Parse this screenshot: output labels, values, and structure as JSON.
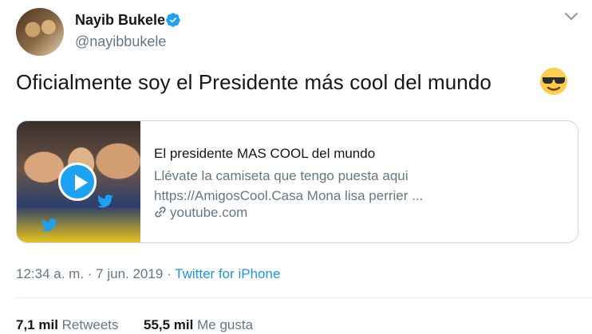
{
  "author": {
    "name": "Nayib Bukele",
    "handle": "@nayibbukele",
    "verified_color": "#1da1f2"
  },
  "tweet": {
    "text": "Oficialmente soy el Presidente más cool del mundo",
    "emoji": "smiling-face-with-sunglasses"
  },
  "card": {
    "title": "El presidente MAS COOL del mundo",
    "description_line1": "Llévate la camiseta que tengo puesta aqui",
    "description_line2": "https://AmigosCool.Casa Mona lisa perrier ...",
    "domain": "youtube.com"
  },
  "meta": {
    "timestamp": "12:34 a. m. · 7 jun. 2019",
    "separator": "·",
    "source": "Twitter for iPhone"
  },
  "stats": {
    "retweets_count": "7,1 mil",
    "retweets_label": "Retweets",
    "likes_count": "55,5 mil",
    "likes_label": "Me gusta"
  },
  "colors": {
    "accent": "#1b95e0",
    "text": "#14171a",
    "secondary": "#657786"
  }
}
